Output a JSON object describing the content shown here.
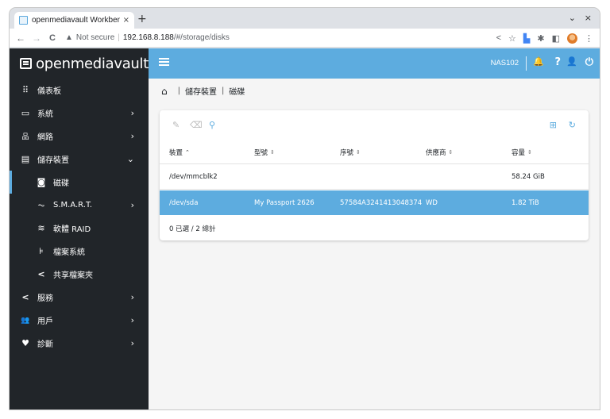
{
  "browser": {
    "tab_title": "openmediavault Workben",
    "tab_close": "×",
    "new_tab": "+",
    "minimize": "⌄",
    "close": "×",
    "back": "←",
    "forward": "→",
    "reload": "C",
    "security_icon": "warning-icon",
    "security_label": "Not secure",
    "url_host": "192.168.8.188",
    "url_path": "/#/storage/disks"
  },
  "brand": {
    "name": "openmediavault"
  },
  "sidebar": {
    "items": [
      {
        "label": "儀表板",
        "icon": "dashboard-grid-icon",
        "glyph": "⠿",
        "chevron": ""
      },
      {
        "label": "系統",
        "icon": "laptop-icon",
        "glyph": "▭",
        "chevron": "›"
      },
      {
        "label": "網路",
        "icon": "network-icon",
        "glyph": "品",
        "chevron": "›"
      },
      {
        "label": "儲存裝置",
        "icon": "storage-icon",
        "glyph": "▤",
        "chevron": "⌄"
      },
      {
        "label": "磁碟",
        "icon": "disk-icon",
        "glyph": "◙",
        "chevron": ""
      },
      {
        "label": "S.M.A.R.T.",
        "icon": "heartbeat-icon",
        "glyph": "⏦",
        "chevron": "›"
      },
      {
        "label": "軟體 RAID",
        "icon": "database-icon",
        "glyph": "≋",
        "chevron": ""
      },
      {
        "label": "檔案系統",
        "icon": "file-tree-icon",
        "glyph": "⊧",
        "chevron": ""
      },
      {
        "label": "共享檔案夾",
        "icon": "share-icon",
        "glyph": "<",
        "chevron": ""
      },
      {
        "label": "服務",
        "icon": "share-icon",
        "glyph": "<",
        "chevron": "›"
      },
      {
        "label": "用戶",
        "icon": "users-icon",
        "glyph": "👥",
        "chevron": "›"
      },
      {
        "label": "診斷",
        "icon": "heart-pulse-icon",
        "glyph": "♥",
        "chevron": "›"
      }
    ]
  },
  "topbar": {
    "hostname": "NAS102",
    "bell": "🔔",
    "help": "?",
    "user": "👤",
    "power": "⏻"
  },
  "breadcrumb": {
    "home": "⌂",
    "sep": "|",
    "level1": "儲存裝置",
    "level2": "磁碟"
  },
  "table": {
    "columns": [
      "裝置",
      "型號",
      "序號",
      "供應商",
      "容量"
    ],
    "sort_indicator_active": "⌃",
    "sort_indicator": "⇕",
    "rows": [
      {
        "device": "/dev/mmcblk2",
        "model": "",
        "serial": "",
        "vendor": "",
        "capacity": "58.24 GiB",
        "selected": false
      },
      {
        "device": "/dev/sda",
        "model": "My Passport 2626",
        "serial": "57584A3241413048374",
        "vendor": "WD",
        "capacity": "1.82 TiB",
        "selected": true
      }
    ],
    "footer": "0 已選 / 2 總計"
  },
  "colors": {
    "accent": "#5dacdf",
    "sidebar": "#212529",
    "icon_dim": "#c4c4c4"
  }
}
